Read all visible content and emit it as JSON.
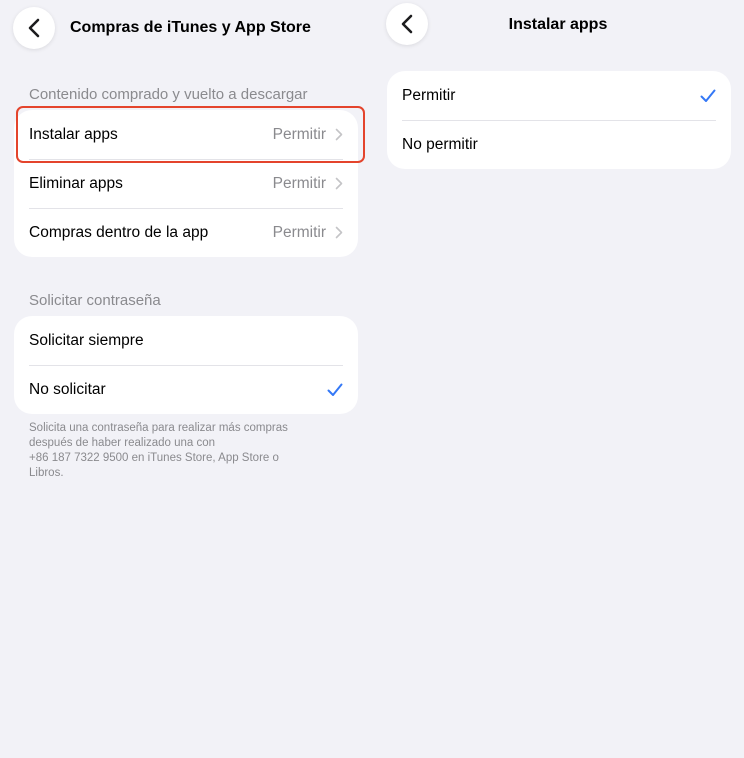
{
  "left": {
    "nav": {
      "title": "Compras de iTunes y App Store"
    },
    "section1": {
      "header": "Contenido comprado y vuelto a descargar",
      "rows": [
        {
          "label": "Instalar apps",
          "value": "Permitir"
        },
        {
          "label": "Eliminar apps",
          "value": "Permitir"
        },
        {
          "label": "Compras dentro de la app",
          "value": "Permitir"
        }
      ]
    },
    "section2": {
      "header": "Solicitar contraseña",
      "rows": [
        {
          "label": "Solicitar siempre",
          "checked": false
        },
        {
          "label": "No solicitar",
          "checked": true
        }
      ],
      "footer_line1": "Solicita una contraseña para realizar más compras",
      "footer_line2": "después de haber realizado una con",
      "footer_line3": "+86 187 7322 9500 en iTunes Store, App Store o",
      "footer_line4": "Libros."
    }
  },
  "right": {
    "nav": {
      "title": "Instalar apps"
    },
    "rows": [
      {
        "label": "Permitir",
        "checked": true
      },
      {
        "label": "No permitir",
        "checked": false
      }
    ]
  },
  "colors": {
    "background": "#f2f2f7",
    "accent": "#3478f6",
    "highlight": "#e4442c",
    "secondary_text": "#8a8a8e"
  },
  "icons": {
    "back": "chevron-left-icon",
    "disclosure": "chevron-right-icon",
    "selected": "checkmark-icon"
  }
}
